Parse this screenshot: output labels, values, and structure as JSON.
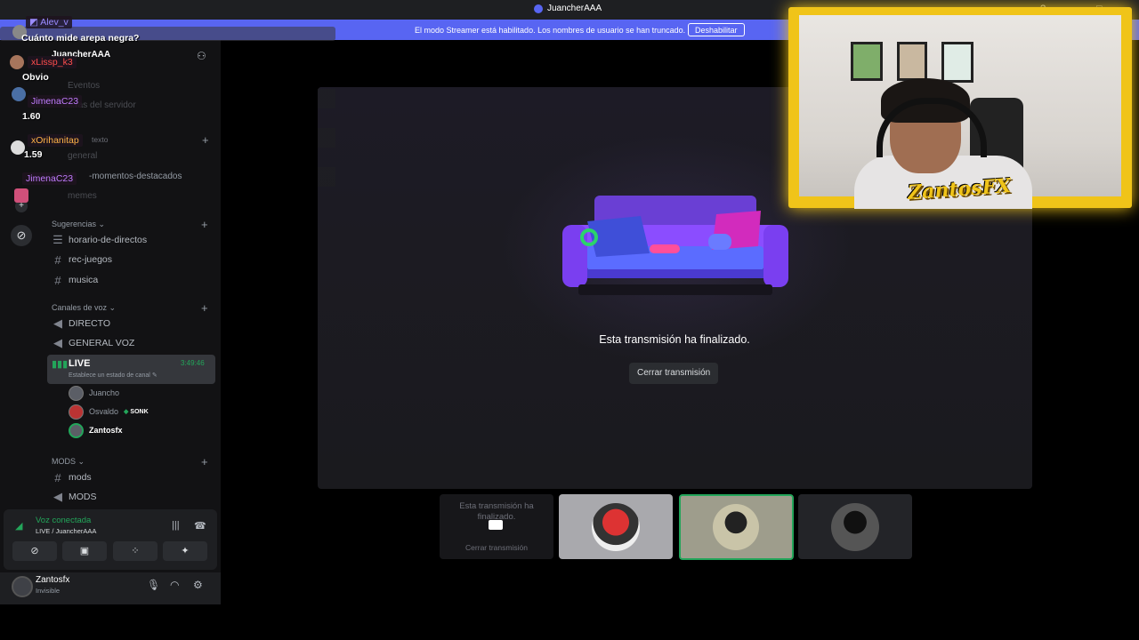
{
  "window": {
    "title": "JuancherAAA"
  },
  "banner": {
    "text": "El modo Streamer está habilitado. Los nombres de usuario se han truncado.",
    "button": "Deshabilitar"
  },
  "server": {
    "name": "JuancherAAA"
  },
  "sidebar": {
    "faint_items": [
      "Eventos",
      "...ras del servidor",
      "texto",
      "general",
      "-momentos-destacados",
      "memes"
    ],
    "sections": {
      "sugerencias": "Sugerencias",
      "voz": "Canales de voz",
      "mods": "MODS"
    },
    "sugerencias_channels": [
      "horario-de-directos",
      "rec-juegos",
      "musica"
    ],
    "voice_channels": [
      "DIRECTO",
      "GENERAL VOZ"
    ],
    "live": {
      "label": "LIVE",
      "time": "3:49:46",
      "status": "Establece un estado de canal"
    },
    "voice_users": [
      {
        "name": "Juancho"
      },
      {
        "name": "Osvaldo",
        "badge": "SONK"
      },
      {
        "name": "Zantosfx"
      }
    ],
    "mods_channels": [
      "mods",
      "MODS"
    ]
  },
  "voice_panel": {
    "title": "Voz conectada",
    "subtitle": "LIVE / JuancherAAA"
  },
  "user_panel": {
    "name": "Zantosfx",
    "status": "Invisible"
  },
  "stage": {
    "ended_text": "Esta transmisión ha finalizado.",
    "close_button": "Cerrar transmisión"
  },
  "tiles": {
    "first_text": "Esta transmisión ha finalizado.",
    "first_button": "Cerrar transmisión"
  },
  "webcam": {
    "logo_text": "ZantosFX"
  },
  "chat": [
    {
      "user": "Alev_v",
      "color": "#9b8cff",
      "message": "Cuánto mide arepa negra?"
    },
    {
      "user": "xLissp_k3",
      "color": "#ff4d4d",
      "message": "Obvio"
    },
    {
      "user": "JimenaC23",
      "color": "#c17cff",
      "message": "1.60"
    },
    {
      "user": "xOrihanitap",
      "color": "#ffb347",
      "message": "1.59"
    },
    {
      "user": "JimenaC23",
      "color": "#c17cff",
      "message": ""
    }
  ],
  "colors": {
    "accent": "#5865f2",
    "online": "#23a55a",
    "webcam_frame": "#f0c419"
  }
}
